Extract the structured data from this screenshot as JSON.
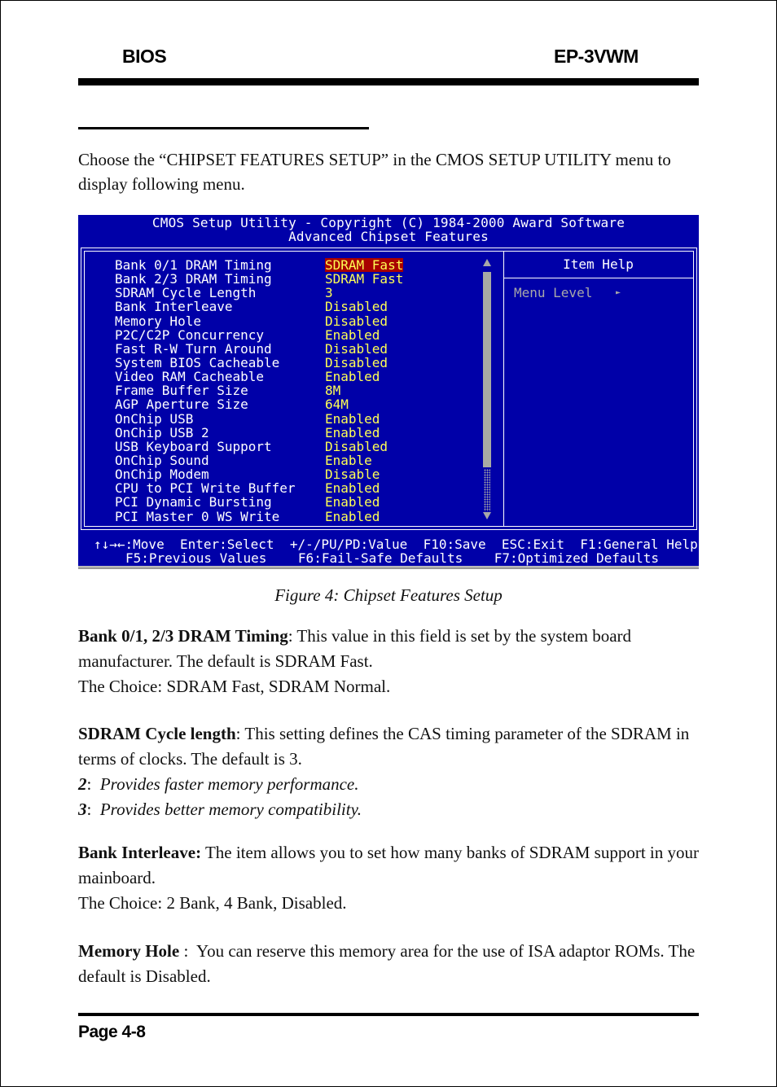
{
  "header": {
    "left": "BIOS",
    "right": "EP-3VWM"
  },
  "intro": "Choose the “CHIPSET FEATURES SETUP” in the CMOS SETUP UTILITY menu to display following menu.",
  "bios": {
    "title_line1": "CMOS Setup Utility - Copyright (C) 1984-2000 Award Software",
    "title_line2": "Advanced Chipset Features",
    "colors": {
      "background": "#0000a8",
      "value": "#ffff54",
      "selected_bg": "#a80000",
      "dim": "#a8a8a8"
    },
    "settings": [
      {
        "label": "Bank 0/1 DRAM Timing",
        "value": "SDRAM Fast",
        "selected": true
      },
      {
        "label": "Bank 2/3 DRAM Timing",
        "value": "SDRAM Fast"
      },
      {
        "label": "SDRAM Cycle Length",
        "value": "3"
      },
      {
        "label": "Bank Interleave",
        "value": "Disabled"
      },
      {
        "label": "Memory Hole",
        "value": "Disabled"
      },
      {
        "label": "P2C/C2P Concurrency",
        "value": "Enabled"
      },
      {
        "label": "Fast R-W Turn Around",
        "value": "Disabled"
      },
      {
        "label": "System BIOS Cacheable",
        "value": "Disabled"
      },
      {
        "label": "Video RAM Cacheable",
        "value": "Enabled"
      },
      {
        "label": "Frame Buffer Size",
        "value": "8M"
      },
      {
        "label": "AGP Aperture Size",
        "value": "64M"
      },
      {
        "label": "OnChip USB",
        "value": "Enabled"
      },
      {
        "label": "OnChip USB 2",
        "value": "Enabled"
      },
      {
        "label": "USB Keyboard Support",
        "value": "Disabled"
      },
      {
        "label": "OnChip Sound",
        "value": "Enable"
      },
      {
        "label": "OnChip Modem",
        "value": "Disable"
      },
      {
        "label": "CPU to PCI Write Buffer",
        "value": "Enabled"
      },
      {
        "label": "PCI Dynamic Bursting",
        "value": "Enabled"
      },
      {
        "label": "PCI Master 0 WS Write",
        "value": "Enabled"
      }
    ],
    "help_title": "Item Help",
    "menu_level_label": "Menu Level",
    "menu_level_arrow": "►",
    "status_line1": "↑↓→←:Move  Enter:Select  +/-/PU/PD:Value  F10:Save  ESC:Exit  F1:General Help",
    "status_line2": "F5:Previous Values    F6:Fail-Safe Defaults    F7:Optimized Defaults"
  },
  "caption": "Figure 4:  Chipset Features Setup",
  "sections": [
    {
      "term": "Bank 0/1, 2/3 DRAM Timing",
      "sep": ": ",
      "text": "This value in this field is set by the system board manufacturer.  The default is SDRAM Fast.",
      "choice": "The Choice: SDRAM Fast, SDRAM Normal."
    },
    {
      "term": "SDRAM Cycle length",
      "sep": ": ",
      "text": "This setting defines the CAS timing parameter of the SDRAM in terms of clocks. The default is 3.",
      "options": [
        {
          "key": "2",
          "desc": "Provides faster memory performance."
        },
        {
          "key": "3",
          "desc": "Provides better memory compatibility."
        }
      ]
    },
    {
      "term": "Bank Interleave:",
      "sep": " ",
      "text": "The item allows you to set how many banks of SDRAM support in your mainboard.",
      "choice": "The Choice: 2 Bank, 4 Bank, Disabled."
    },
    {
      "term": "Memory Hole",
      "sep": " :  ",
      "text": "You can reserve this memory area for the use of ISA adaptor ROMs. The default is Disabled."
    }
  ],
  "footer": {
    "page": "Page 4-8"
  }
}
